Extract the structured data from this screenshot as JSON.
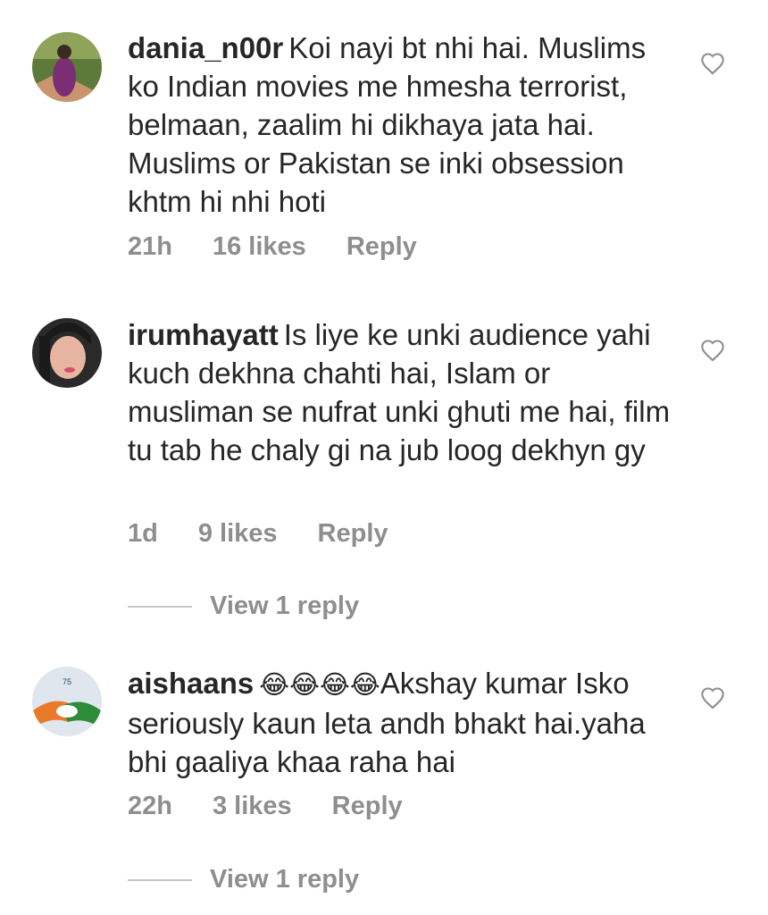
{
  "comments": [
    {
      "username": "dania_n00r",
      "text": "Koi nayi bt nhi hai. Muslims ko Indian movies me hmesha terrorist, belmaan, zaalim hi dikhaya jata hai. Muslims or Pakistan se inki obsession khtm hi nhi hoti",
      "emoji": "",
      "text_after": "",
      "time": "21h",
      "likes": "16 likes",
      "reply_label": "Reply",
      "view_replies": "",
      "avatar_colors": [
        "#6d7f3f",
        "#7b2e74",
        "#c78a6a"
      ]
    },
    {
      "username": "irumhayatt",
      "text": "Is liye ke unki audience yahi kuch dekhna chahti hai, Islam or musliman se nufrat unki ghuti me hai, film tu tab he chaly gi na jub loog dekhyn gy",
      "emoji": "",
      "text_after": "",
      "time": "1d",
      "likes": "9 likes",
      "reply_label": "Reply",
      "view_replies": "View 1 reply",
      "avatar_colors": [
        "#1e1e1e",
        "#e8b5a3",
        "#d4506a"
      ]
    },
    {
      "username": "aishaans",
      "text": "",
      "emoji": "😂😂😂😂",
      "text_after": "Akshay kumar Isko seriously kaun leta andh bhakt hai.yaha bhi gaaliya khaa raha hai",
      "time": "22h",
      "likes": "3 likes",
      "reply_label": "Reply",
      "view_replies": "View 1 reply",
      "avatar_colors": [
        "#e97a2a",
        "#2e8b3a",
        "#ffffff"
      ]
    }
  ],
  "icons": {
    "like": "heart-outline-icon"
  }
}
